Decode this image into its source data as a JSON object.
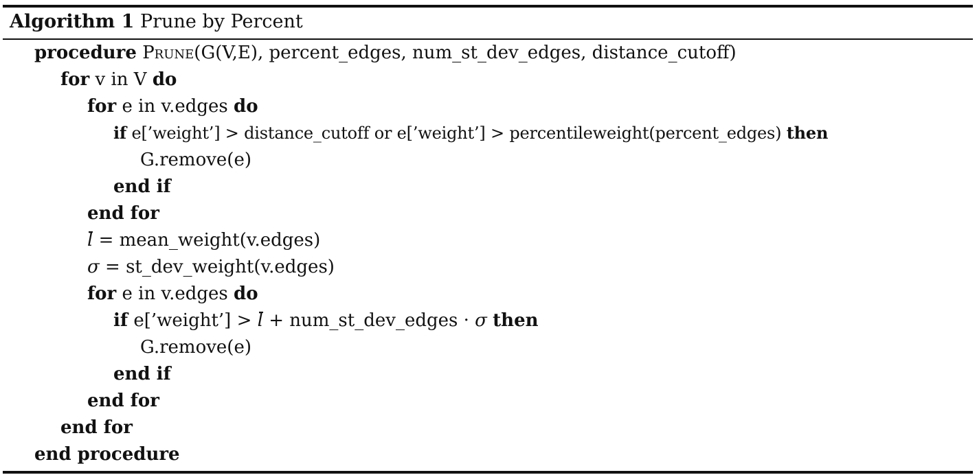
{
  "caption": {
    "label": "Algorithm 1",
    "title": "Prune by Percent"
  },
  "code": {
    "l1": {
      "kw": "procedure",
      "name": "Prune",
      "args": "(G(V,E), percent_edges, num_st_dev_edges, distance_cutoff)"
    },
    "l2": {
      "kw": "for",
      "body": "v in V",
      "kw2": "do"
    },
    "l3": {
      "kw": "for",
      "body": "e in v.edges",
      "kw2": "do"
    },
    "l4": {
      "kw": "if",
      "body": "e[’weight’] > distance_cutoff or e[’weight’] > percentileweight(percent_edges)",
      "kw2": "then"
    },
    "l5": {
      "body": "G.remove(e)"
    },
    "l6": {
      "kw": "end if"
    },
    "l7": {
      "kw": "end for"
    },
    "l8": {
      "sym": "l",
      "body": "= mean_weight(v.edges)"
    },
    "l9": {
      "sym": "σ",
      "body": "= st_dev_weight(v.edges)"
    },
    "l10": {
      "kw": "for",
      "body": "e in v.edges",
      "kw2": "do"
    },
    "l11": {
      "kw": "if",
      "body": "e[’weight’] >",
      "sym": "l",
      "body2": "+ num_st_dev_edges ·",
      "sym2": "σ",
      "kw2": "then"
    },
    "l12": {
      "body": "G.remove(e)"
    },
    "l13": {
      "kw": "end if"
    },
    "l14": {
      "kw": "end for"
    },
    "l15": {
      "kw": "end for"
    },
    "l16": {
      "kw": "end procedure"
    }
  }
}
